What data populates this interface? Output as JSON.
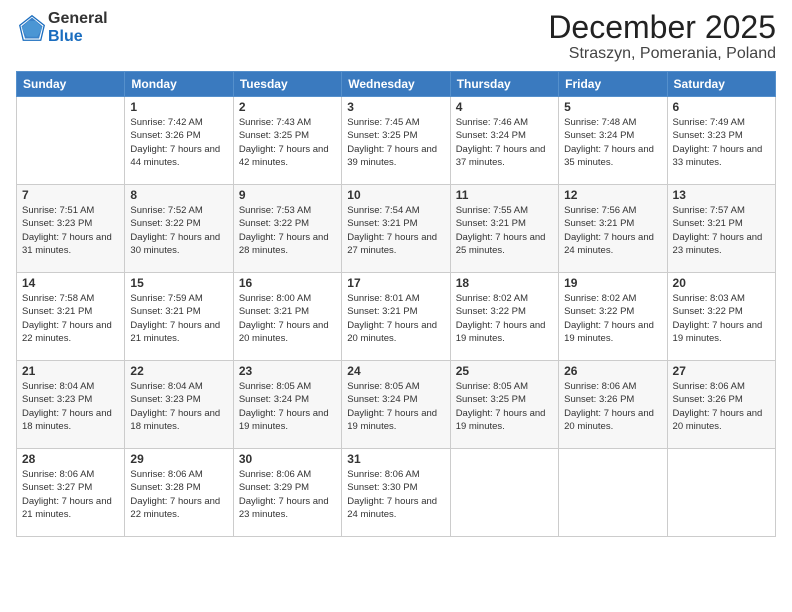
{
  "logo": {
    "general": "General",
    "blue": "Blue"
  },
  "title": "December 2025",
  "subtitle": "Straszyn, Pomerania, Poland",
  "weekdays": [
    "Sunday",
    "Monday",
    "Tuesday",
    "Wednesday",
    "Thursday",
    "Friday",
    "Saturday"
  ],
  "weeks": [
    [
      {
        "day": "",
        "sunrise": "",
        "sunset": "",
        "daylight": ""
      },
      {
        "day": "1",
        "sunrise": "Sunrise: 7:42 AM",
        "sunset": "Sunset: 3:26 PM",
        "daylight": "Daylight: 7 hours and 44 minutes."
      },
      {
        "day": "2",
        "sunrise": "Sunrise: 7:43 AM",
        "sunset": "Sunset: 3:25 PM",
        "daylight": "Daylight: 7 hours and 42 minutes."
      },
      {
        "day": "3",
        "sunrise": "Sunrise: 7:45 AM",
        "sunset": "Sunset: 3:25 PM",
        "daylight": "Daylight: 7 hours and 39 minutes."
      },
      {
        "day": "4",
        "sunrise": "Sunrise: 7:46 AM",
        "sunset": "Sunset: 3:24 PM",
        "daylight": "Daylight: 7 hours and 37 minutes."
      },
      {
        "day": "5",
        "sunrise": "Sunrise: 7:48 AM",
        "sunset": "Sunset: 3:24 PM",
        "daylight": "Daylight: 7 hours and 35 minutes."
      },
      {
        "day": "6",
        "sunrise": "Sunrise: 7:49 AM",
        "sunset": "Sunset: 3:23 PM",
        "daylight": "Daylight: 7 hours and 33 minutes."
      }
    ],
    [
      {
        "day": "7",
        "sunrise": "Sunrise: 7:51 AM",
        "sunset": "Sunset: 3:23 PM",
        "daylight": "Daylight: 7 hours and 31 minutes."
      },
      {
        "day": "8",
        "sunrise": "Sunrise: 7:52 AM",
        "sunset": "Sunset: 3:22 PM",
        "daylight": "Daylight: 7 hours and 30 minutes."
      },
      {
        "day": "9",
        "sunrise": "Sunrise: 7:53 AM",
        "sunset": "Sunset: 3:22 PM",
        "daylight": "Daylight: 7 hours and 28 minutes."
      },
      {
        "day": "10",
        "sunrise": "Sunrise: 7:54 AM",
        "sunset": "Sunset: 3:21 PM",
        "daylight": "Daylight: 7 hours and 27 minutes."
      },
      {
        "day": "11",
        "sunrise": "Sunrise: 7:55 AM",
        "sunset": "Sunset: 3:21 PM",
        "daylight": "Daylight: 7 hours and 25 minutes."
      },
      {
        "day": "12",
        "sunrise": "Sunrise: 7:56 AM",
        "sunset": "Sunset: 3:21 PM",
        "daylight": "Daylight: 7 hours and 24 minutes."
      },
      {
        "day": "13",
        "sunrise": "Sunrise: 7:57 AM",
        "sunset": "Sunset: 3:21 PM",
        "daylight": "Daylight: 7 hours and 23 minutes."
      }
    ],
    [
      {
        "day": "14",
        "sunrise": "Sunrise: 7:58 AM",
        "sunset": "Sunset: 3:21 PM",
        "daylight": "Daylight: 7 hours and 22 minutes."
      },
      {
        "day": "15",
        "sunrise": "Sunrise: 7:59 AM",
        "sunset": "Sunset: 3:21 PM",
        "daylight": "Daylight: 7 hours and 21 minutes."
      },
      {
        "day": "16",
        "sunrise": "Sunrise: 8:00 AM",
        "sunset": "Sunset: 3:21 PM",
        "daylight": "Daylight: 7 hours and 20 minutes."
      },
      {
        "day": "17",
        "sunrise": "Sunrise: 8:01 AM",
        "sunset": "Sunset: 3:21 PM",
        "daylight": "Daylight: 7 hours and 20 minutes."
      },
      {
        "day": "18",
        "sunrise": "Sunrise: 8:02 AM",
        "sunset": "Sunset: 3:22 PM",
        "daylight": "Daylight: 7 hours and 19 minutes."
      },
      {
        "day": "19",
        "sunrise": "Sunrise: 8:02 AM",
        "sunset": "Sunset: 3:22 PM",
        "daylight": "Daylight: 7 hours and 19 minutes."
      },
      {
        "day": "20",
        "sunrise": "Sunrise: 8:03 AM",
        "sunset": "Sunset: 3:22 PM",
        "daylight": "Daylight: 7 hours and 19 minutes."
      }
    ],
    [
      {
        "day": "21",
        "sunrise": "Sunrise: 8:04 AM",
        "sunset": "Sunset: 3:23 PM",
        "daylight": "Daylight: 7 hours and 18 minutes."
      },
      {
        "day": "22",
        "sunrise": "Sunrise: 8:04 AM",
        "sunset": "Sunset: 3:23 PM",
        "daylight": "Daylight: 7 hours and 18 minutes."
      },
      {
        "day": "23",
        "sunrise": "Sunrise: 8:05 AM",
        "sunset": "Sunset: 3:24 PM",
        "daylight": "Daylight: 7 hours and 19 minutes."
      },
      {
        "day": "24",
        "sunrise": "Sunrise: 8:05 AM",
        "sunset": "Sunset: 3:24 PM",
        "daylight": "Daylight: 7 hours and 19 minutes."
      },
      {
        "day": "25",
        "sunrise": "Sunrise: 8:05 AM",
        "sunset": "Sunset: 3:25 PM",
        "daylight": "Daylight: 7 hours and 19 minutes."
      },
      {
        "day": "26",
        "sunrise": "Sunrise: 8:06 AM",
        "sunset": "Sunset: 3:26 PM",
        "daylight": "Daylight: 7 hours and 20 minutes."
      },
      {
        "day": "27",
        "sunrise": "Sunrise: 8:06 AM",
        "sunset": "Sunset: 3:26 PM",
        "daylight": "Daylight: 7 hours and 20 minutes."
      }
    ],
    [
      {
        "day": "28",
        "sunrise": "Sunrise: 8:06 AM",
        "sunset": "Sunset: 3:27 PM",
        "daylight": "Daylight: 7 hours and 21 minutes."
      },
      {
        "day": "29",
        "sunrise": "Sunrise: 8:06 AM",
        "sunset": "Sunset: 3:28 PM",
        "daylight": "Daylight: 7 hours and 22 minutes."
      },
      {
        "day": "30",
        "sunrise": "Sunrise: 8:06 AM",
        "sunset": "Sunset: 3:29 PM",
        "daylight": "Daylight: 7 hours and 23 minutes."
      },
      {
        "day": "31",
        "sunrise": "Sunrise: 8:06 AM",
        "sunset": "Sunset: 3:30 PM",
        "daylight": "Daylight: 7 hours and 24 minutes."
      },
      {
        "day": "",
        "sunrise": "",
        "sunset": "",
        "daylight": ""
      },
      {
        "day": "",
        "sunrise": "",
        "sunset": "",
        "daylight": ""
      },
      {
        "day": "",
        "sunrise": "",
        "sunset": "",
        "daylight": ""
      }
    ]
  ]
}
